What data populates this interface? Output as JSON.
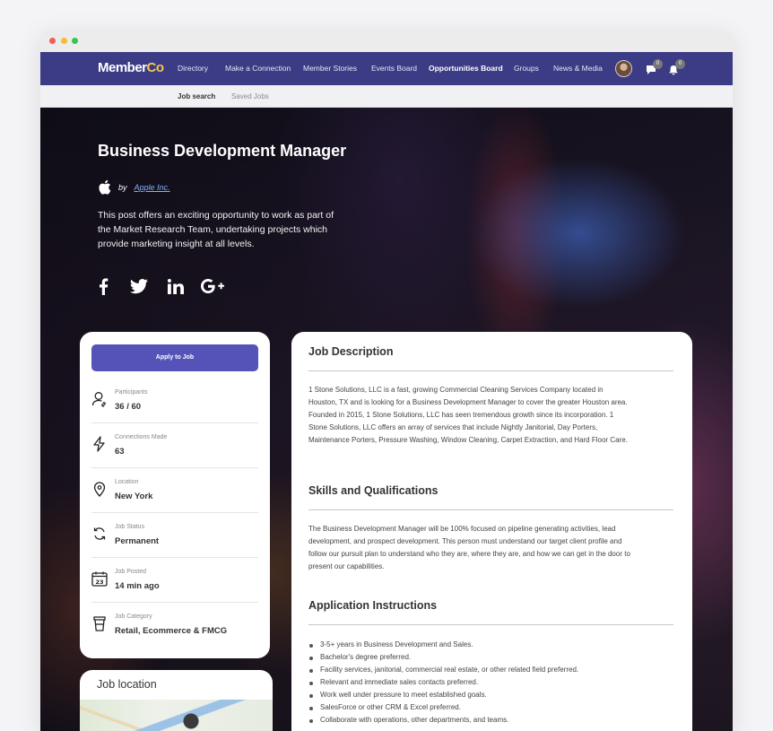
{
  "app": {
    "logo_main": "Member",
    "logo_accent": "Co",
    "nav": [
      "Directory",
      "Make a Connection",
      "Member Stories",
      "Events Board",
      "Opportunities Board",
      "Groups",
      "News & Media"
    ],
    "active_nav": "Opportunities Board",
    "messages_count": "0",
    "notifications_count": "0",
    "subnav": [
      "Job search",
      "Saved Jobs"
    ]
  },
  "job": {
    "title": "Business Development Manager",
    "by": "by",
    "company": "Apple Inc.",
    "summary": "This post offers an exciting opportunity to work as part of the Market Research Team, undertaking projects which provide marketing insight at all levels.",
    "social": [
      "facebook-icon",
      "twitter-icon",
      "linkedin-icon",
      "google-plus-icon"
    ]
  },
  "sidebar": {
    "apply_label": "Apply to Job",
    "stats": [
      {
        "label": "Participants",
        "value": "36 / 60",
        "icon": "user-icon"
      },
      {
        "label": "Connections Made",
        "value": "63",
        "icon": "lightning-icon"
      },
      {
        "label": "Location",
        "value": "New York",
        "icon": "location-pin-icon"
      },
      {
        "label": "Job Status",
        "value": "Permanent",
        "icon": "refresh-icon"
      },
      {
        "label": "Job Posted",
        "value": "14 min ago",
        "icon": "calendar-icon"
      },
      {
        "label": "Job Category",
        "value": "Retail, Ecommerce & FMCG",
        "icon": "cup-icon"
      }
    ],
    "map_title": "Job location"
  },
  "details": {
    "description_title": "Job Description",
    "description": "1 Stone Solutions, LLC is a fast, growing Commercial Cleaning Services Company located in Houston, TX and is looking for a Business Development Manager to cover the greater Houston area. Founded in 2015, 1 Stone Solutions, LLC has seen tremendous growth since its incorporation. 1 Stone Solutions, LLC offers an array of services that include Nightly Janitorial, Day Porters, Maintenance Porters, Pressure Washing, Window Cleaning, Carpet Extraction, and Hard Floor Care.",
    "skills_title": "Skills and Qualifications",
    "skills": "The Business Development Manager will be 100% focused on pipeline generating activities, lead development, and prospect development. This person must understand our target client profile and follow our pursuit plan to understand who they are, where they are, and how we can get in the door to present our capabilities.",
    "instructions_title": "Application Instructions",
    "instructions": [
      "3-5+ years in Business Development and Sales.",
      "Bachelor's degree preferred.",
      "Facility services, janitorial, commercial real estate, or other related field preferred.",
      "Relevant and immediate sales contacts preferred.",
      "Work well under pressure to meet established goals.",
      "SalesForce or other CRM & Excel preferred.",
      "Collaborate with operations, other departments, and teams."
    ]
  }
}
